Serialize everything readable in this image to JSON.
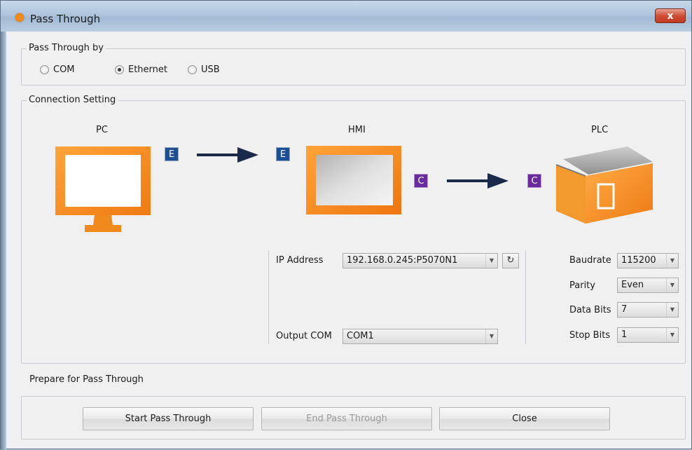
{
  "window": {
    "title": "Pass Through",
    "close_label": "x"
  },
  "pass_through_by": {
    "title": "Pass Through by",
    "options": [
      {
        "label": "COM",
        "checked": false
      },
      {
        "label": "Ethernet",
        "checked": true
      },
      {
        "label": "USB",
        "checked": false
      }
    ]
  },
  "connection": {
    "title": "Connection Setting",
    "devices": {
      "pc": "PC",
      "hmi": "HMI",
      "plc": "PLC"
    },
    "badges": {
      "ethernet": "E",
      "com": "C"
    },
    "ip_address": {
      "label": "IP Address",
      "value": "192.168.0.245:P5070N1"
    },
    "output_com": {
      "label": "Output COM",
      "value": "COM1"
    },
    "baudrate": {
      "label": "Baudrate",
      "value": "115200"
    },
    "parity": {
      "label": "Parity",
      "value": "Even"
    },
    "data_bits": {
      "label": "Data Bits",
      "value": "7"
    },
    "stop_bits": {
      "label": "Stop Bits",
      "value": "1"
    }
  },
  "status": "Prepare for Pass Through",
  "buttons": {
    "start": "Start Pass Through",
    "end": "End Pass Through",
    "close": "Close"
  },
  "colors": {
    "accent": "#f08a1c",
    "ethernet_badge": "#1f4f93",
    "com_badge": "#6b2ba0",
    "arrow": "#1c2a4a"
  }
}
